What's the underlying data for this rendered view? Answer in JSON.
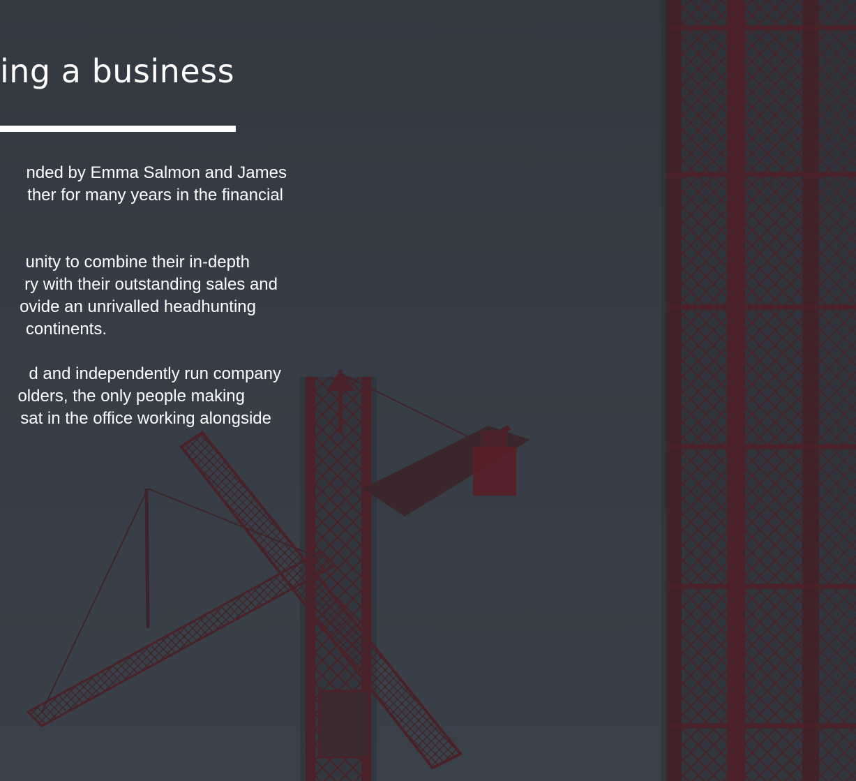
{
  "section": {
    "heading": "ing a business",
    "paragraphs": [
      [
        "nded by Emma Salmon and James",
        "ther for many years in the financial"
      ],
      [
        "unity to combine their in-depth",
        "ry with their outstanding sales and",
        "ovide an unrivalled headhunting",
        "continents."
      ],
      [
        "d and independently run company",
        "olders, the only people making",
        "sat in the office working alongside"
      ]
    ]
  },
  "background": {
    "image": "construction-cranes-at-dusk",
    "overlay_color": "#353c45",
    "crane_color": "#5a1f26"
  }
}
